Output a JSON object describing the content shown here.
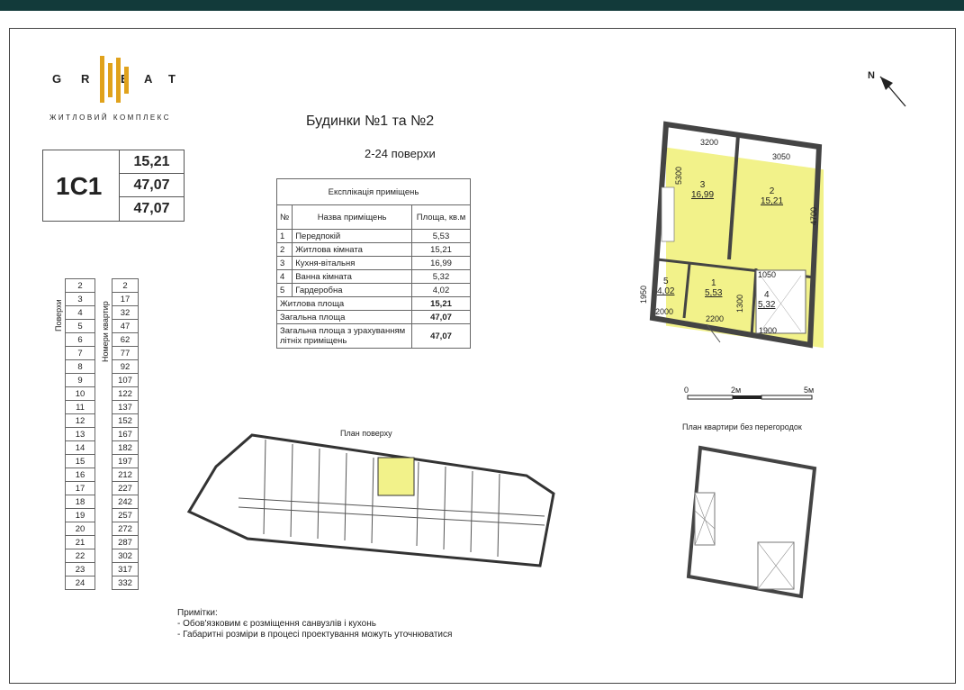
{
  "logo": {
    "letters": [
      "G",
      "R",
      "E",
      "A",
      "T"
    ],
    "subtitle": "ЖИТЛОВИЙ КОМПЛЕКС"
  },
  "unit": {
    "code": "1С1",
    "values": [
      "15,21",
      "47,07",
      "47,07"
    ]
  },
  "header": {
    "title": "Будинки №1 та №2",
    "floors": "2-24 поверхи"
  },
  "explication": {
    "title": "Експлікація приміщень",
    "col_no": "№",
    "col_name": "Назва приміщень",
    "col_area": "Площа, кв.м",
    "rows": [
      {
        "no": "1",
        "name": "Передпокій",
        "area": "5,53"
      },
      {
        "no": "2",
        "name": "Житлова кімната",
        "area": "15,21"
      },
      {
        "no": "3",
        "name": "Кухня-вітальня",
        "area": "16,99"
      },
      {
        "no": "4",
        "name": "Ванна кімната",
        "area": "5,32"
      },
      {
        "no": "5",
        "name": "Гардеробна",
        "area": "4,02"
      }
    ],
    "totals": [
      {
        "name": "Житлова площа",
        "area": "15,21"
      },
      {
        "name": "Загальна площа",
        "area": "47,07"
      },
      {
        "name": "Загальна площа з урахуванням літніх приміщень",
        "area": "47,07"
      }
    ]
  },
  "floor_table": {
    "floors_label": "Поверхи",
    "apts_label": "Номери квартир",
    "floors": [
      "2",
      "3",
      "4",
      "5",
      "6",
      "7",
      "8",
      "9",
      "10",
      "11",
      "12",
      "13",
      "14",
      "15",
      "16",
      "17",
      "18",
      "19",
      "20",
      "21",
      "22",
      "23",
      "24"
    ],
    "apartments": [
      "2",
      "17",
      "32",
      "47",
      "62",
      "77",
      "92",
      "107",
      "122",
      "137",
      "152",
      "167",
      "182",
      "197",
      "212",
      "227",
      "242",
      "257",
      "272",
      "287",
      "302",
      "317",
      "332"
    ]
  },
  "plan": {
    "north": "N",
    "rooms": [
      {
        "no": "3",
        "area": "16,99"
      },
      {
        "no": "2",
        "area": "15,21"
      },
      {
        "no": "5",
        "area": "4,02"
      },
      {
        "no": "1",
        "area": "5,53"
      },
      {
        "no": "4",
        "area": "5,32"
      }
    ],
    "dims": [
      "3200",
      "3050",
      "5300",
      "4700",
      "1950",
      "2000",
      "2200",
      "1050",
      "1900",
      "1300"
    ],
    "scale": [
      "0",
      "2м",
      "5м"
    ],
    "no_partitions_label": "План квартири без перегородок",
    "floor_plan_label": "План поверху"
  },
  "notes": {
    "title": "Примітки:",
    "items": [
      "- Обов'язковим є розміщення санвузлів і кухонь",
      "- Габаритні розміри в процесі проектування можуть уточнюватися"
    ]
  },
  "colors": {
    "highlight": "#f2f28a",
    "topbar": "#123a3a",
    "logo_accent": "#e0a21c"
  }
}
